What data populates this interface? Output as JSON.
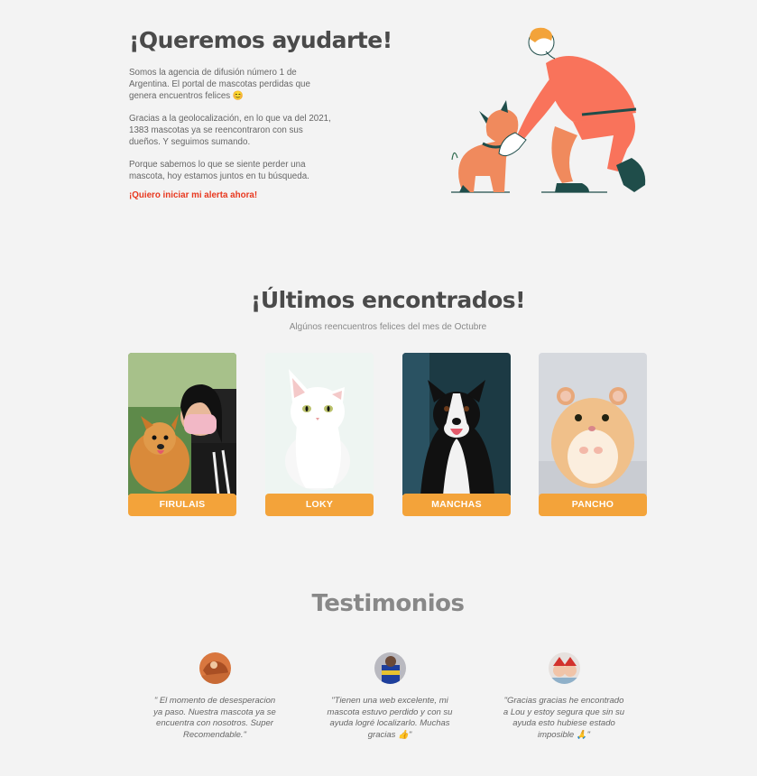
{
  "hero": {
    "title": "¡Queremos ayudarte!",
    "p1": "Somos la agencia de difusión número 1 de Argentina. El portal de mascotas perdidas que genera encuentros felices 😊",
    "p2": "Gracias a la geolocalización, en lo que va del 2021, 1383 mascotas ya se reencontraron con sus dueños. Y seguimos sumando.",
    "p3": "Porque sabemos lo que se siente perder una mascota, hoy estamos juntos en tu búsqueda.",
    "cta": "¡Quiero iniciar mi alerta ahora!"
  },
  "found": {
    "title": "¡Últimos encontrados!",
    "subtitle": "Algúnos reencuentros felices del mes de Octubre",
    "pets": [
      {
        "name": "FIRULAIS"
      },
      {
        "name": "LOKY"
      },
      {
        "name": "MANCHAS"
      },
      {
        "name": "PANCHO"
      }
    ]
  },
  "testimonials": {
    "title": "Testimonios",
    "items": [
      {
        "quote": "\" El momento de desesperacion ya paso. Nuestra mascota ya se encuentra con nosotros. Super Recomendable.\""
      },
      {
        "quote": "\"Tienen una web excelente, mi mascota estuvo perdido y con su ayuda logré localizarlo. Muchas gracias 👍\""
      },
      {
        "quote": "\"Gracias gracias he encontrado a Lou y estoy segura que sin su ayuda esto hubiese estado imposible 🙏\""
      }
    ]
  },
  "colors": {
    "accent_orange": "#f3a33a",
    "cta_red": "#e8381f",
    "background": "#f3f3f3"
  }
}
